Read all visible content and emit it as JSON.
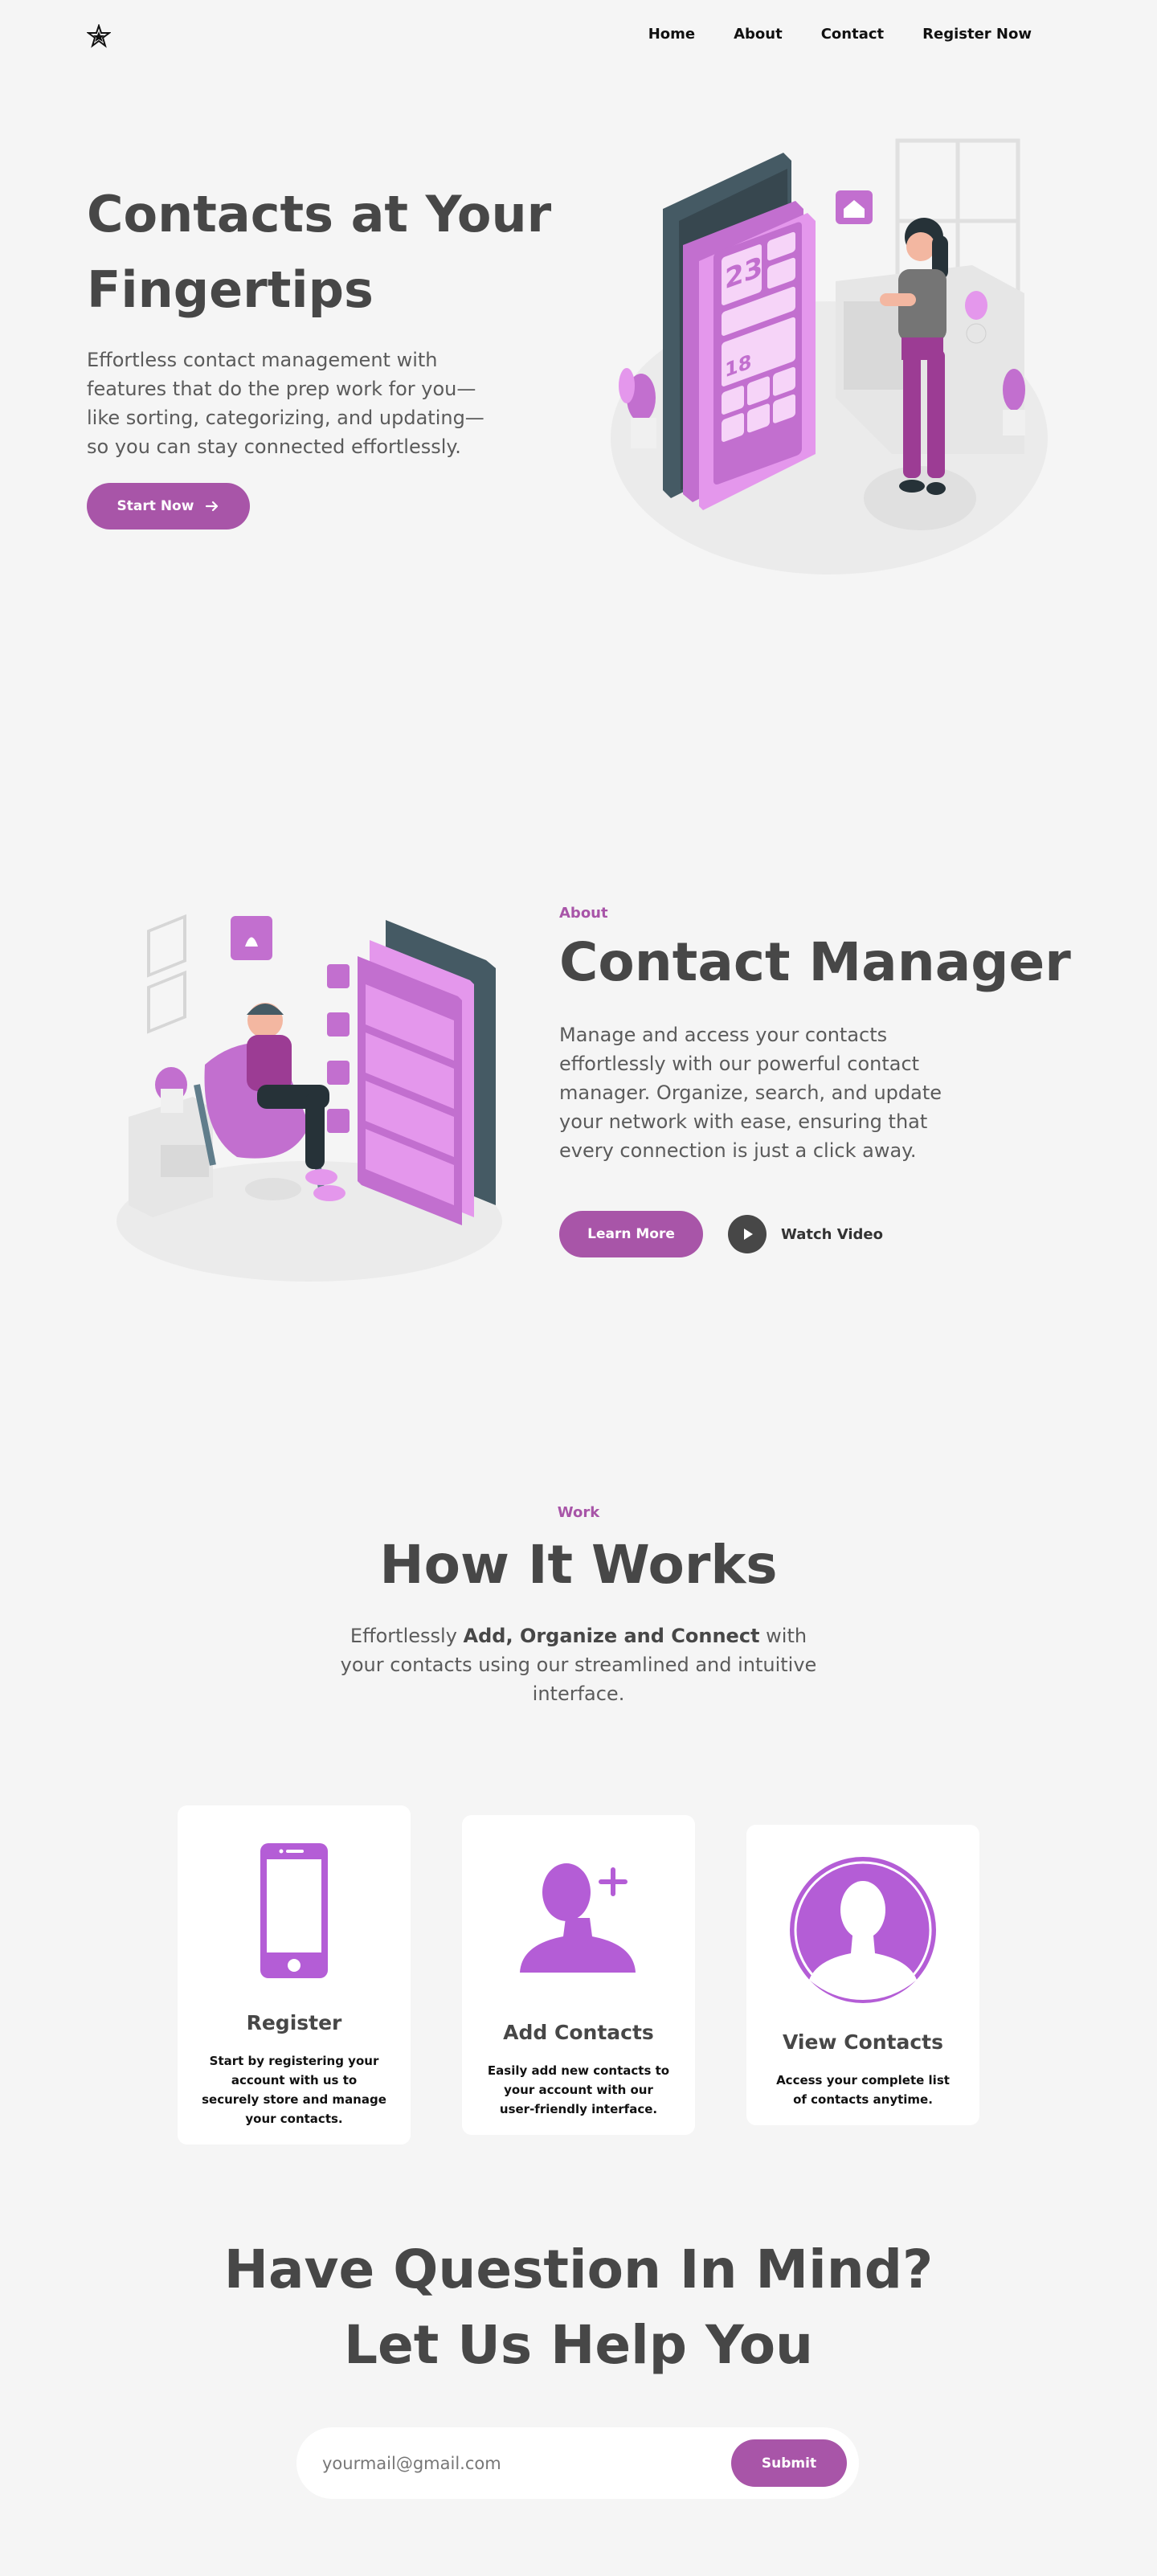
{
  "nav": {
    "links": [
      "Home",
      "About",
      "Contact",
      "Register Now"
    ]
  },
  "hero": {
    "title_line1": "Contacts at Your",
    "title_line2": "Fingertips",
    "text": "Effortless contact management with features that do the prep work for you—like sorting, categorizing, and updating—so you can stay connected effortlessly.",
    "button": "Start Now",
    "phone_date": "23",
    "phone_small_date": "18"
  },
  "about": {
    "tag": "About",
    "title": "Contact Manager",
    "text": "Manage and access your contacts effortlessly with our powerful contact manager. Organize, search, and update your network with ease, ensuring that every connection is just a click away.",
    "learn_button": "Learn More",
    "watch_label": "Watch Video"
  },
  "work": {
    "tag": "Work",
    "title": "How It Works",
    "text_pre": "Effortlessly ",
    "text_bold": "Add, Organize and Connect",
    "text_post": " with your contacts using our streamlined and intuitive interface.",
    "cards": [
      {
        "title": "Register",
        "text": "Start by registering your account with us to securely store and manage your contacts."
      },
      {
        "title": "Add Contacts",
        "text": "Easily add new contacts to your account with our user-friendly interface."
      },
      {
        "title": "View Contacts",
        "text": "Access your complete list of contacts anytime."
      }
    ]
  },
  "contact": {
    "title_line1": "Have Question In Mind?",
    "title_line2": "Let Us Help You",
    "email_placeholder": "yourmail@gmail.com",
    "submit": "Submit"
  },
  "colors": {
    "accent": "#a855a8",
    "icon_purple": "#b45dd6",
    "text_dark": "#474747",
    "background": "#f5f5f5"
  }
}
